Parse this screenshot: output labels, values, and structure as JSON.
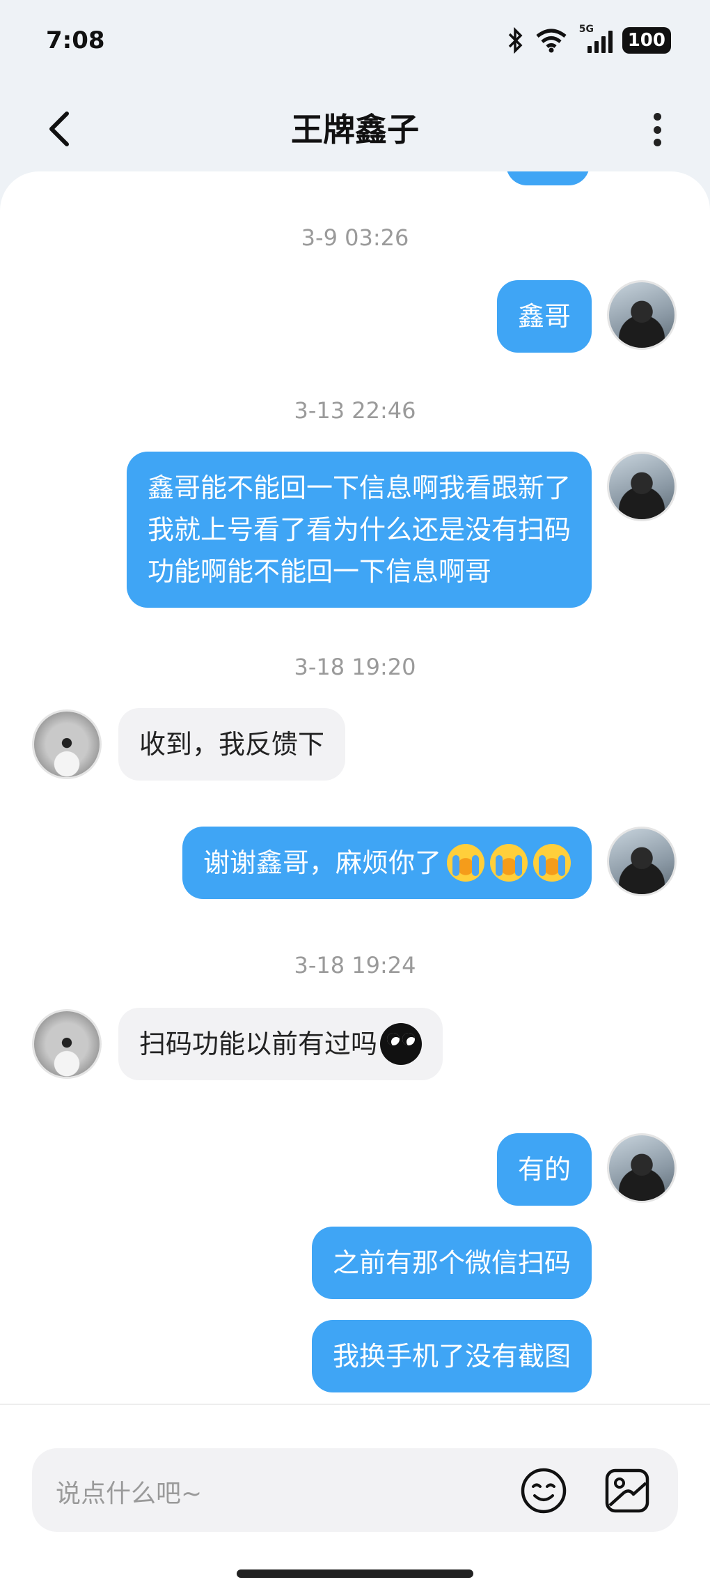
{
  "status": {
    "time": "7:08",
    "network": "5G",
    "battery": "100"
  },
  "header": {
    "title": "王牌鑫子"
  },
  "messages": [
    {
      "timestamp": "3-9 03:26"
    },
    {
      "text": "鑫哥"
    },
    {
      "timestamp": "3-13 22:46"
    },
    {
      "text": "鑫哥能不能回一下信息啊我看跟新了\n我就上号看了看为什么还是没有扫码\n功能啊能不能回一下信息啊哥"
    },
    {
      "timestamp": "3-18 19:20"
    },
    {
      "text": "收到，我反馈下"
    },
    {
      "text": "谢谢鑫哥，麻烦你了"
    },
    {
      "timestamp": "3-18 19:24"
    },
    {
      "text": "扫码功能以前有过吗"
    },
    {
      "text": "有的"
    },
    {
      "text": "之前有那个微信扫码"
    },
    {
      "text": "我换手机了没有截图"
    }
  ],
  "input": {
    "placeholder": "说点什么吧~"
  },
  "colors": {
    "outgoing_bubble": "#3fa5f5",
    "incoming_bubble": "#f2f2f4"
  },
  "icons": [
    "back-arrow-icon",
    "more-vertical-icon",
    "emoji-icon",
    "image-icon",
    "crying-emoji",
    "sweat-black-emoji"
  ]
}
